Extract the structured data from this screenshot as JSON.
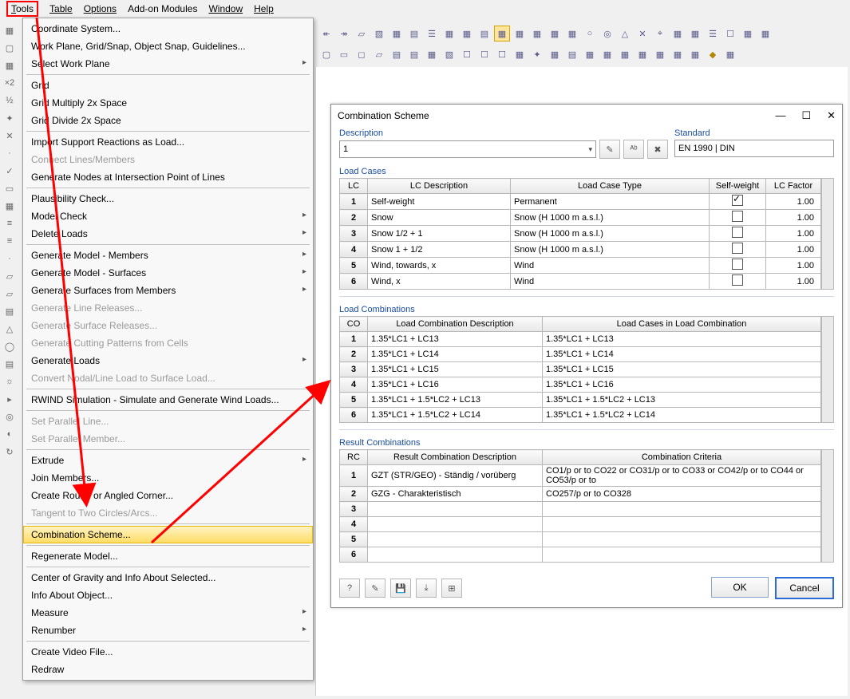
{
  "menubar": {
    "tools": "Tools",
    "table": "Table",
    "options": "Options",
    "addon": "Add-on Modules",
    "window": "Window",
    "help": "Help"
  },
  "menu": {
    "coord": "Coordinate System...",
    "workplane": "Work Plane, Grid/Snap, Object Snap, Guidelines...",
    "selectwp": "Select Work Plane",
    "grid": "Grid",
    "gridmul": "Grid Multiply 2x Space",
    "griddiv": "Grid Divide 2x Space",
    "impsupport": "Import Support Reactions as Load...",
    "connect": "Connect Lines/Members",
    "gennodes": "Generate Nodes at Intersection Point of Lines",
    "plaus": "Plausibility Check...",
    "modelcheck": "Model Check",
    "delloads": "Delete Loads",
    "genmembers": "Generate Model - Members",
    "gensurfaces": "Generate Model - Surfaces",
    "gensurffrom": "Generate Surfaces from Members",
    "genlinerel": "Generate Line Releases...",
    "gensurfrel": "Generate Surface Releases...",
    "gencut": "Generate Cutting Patterns from Cells",
    "genloads": "Generate Loads",
    "convnodal": "Convert Nodal/Line Load to Surface Load...",
    "rwind": "RWIND Simulation - Simulate and Generate Wind Loads...",
    "setparline": "Set Parallel Line...",
    "setparmem": "Set Parallel Member...",
    "extrude": "Extrude",
    "joinmem": "Join Members...",
    "createround": "Create Round or Angled Corner...",
    "tangent": "Tangent to Two Circles/Arcs...",
    "combsch": "Combination Scheme...",
    "regen": "Regenerate Model...",
    "cog": "Center of Gravity and Info About Selected...",
    "infoobj": "Info About Object...",
    "measure": "Measure",
    "renumber": "Renumber",
    "createvid": "Create Video File...",
    "redraw": "Redraw"
  },
  "dialog": {
    "title": "Combination Scheme",
    "descLabel": "Description",
    "descValue": "1",
    "stdLabel": "Standard",
    "stdValue": "EN 1990 | DIN",
    "loadCasesTitle": "Load Cases",
    "loadCasesHeaders": {
      "lc": "LC",
      "desc": "LC Description",
      "type": "Load Case Type",
      "sw": "Self-weight",
      "factor": "LC Factor"
    },
    "loadCases": [
      {
        "n": "1",
        "desc": "Self-weight",
        "type": "Permanent",
        "sw": true,
        "factor": "1.00"
      },
      {
        "n": "2",
        "desc": "Snow",
        "type": "Snow (H <le> 1000 m a.s.l.)",
        "sw": false,
        "factor": "1.00"
      },
      {
        "n": "3",
        "desc": "Snow 1/2 + 1",
        "type": "Snow (H <le> 1000 m a.s.l.)",
        "sw": false,
        "factor": "1.00"
      },
      {
        "n": "4",
        "desc": "Snow 1 + 1/2",
        "type": "Snow (H <le> 1000 m a.s.l.)",
        "sw": false,
        "factor": "1.00"
      },
      {
        "n": "5",
        "desc": "Wind, towards, x",
        "type": "Wind",
        "sw": false,
        "factor": "1.00"
      },
      {
        "n": "6",
        "desc": "Wind, x",
        "type": "Wind",
        "sw": false,
        "factor": "1.00"
      }
    ],
    "loadCombTitle": "Load Combinations",
    "loadCombHeaders": {
      "co": "CO",
      "desc": "Load Combination Description",
      "cases": "Load Cases in Load Combination"
    },
    "loadComb": [
      {
        "n": "1",
        "desc": "1.35*LC1 + LC13",
        "cases": "1.35*LC1 + LC13"
      },
      {
        "n": "2",
        "desc": "1.35*LC1 + LC14",
        "cases": "1.35*LC1 + LC14"
      },
      {
        "n": "3",
        "desc": "1.35*LC1 + LC15",
        "cases": "1.35*LC1 + LC15"
      },
      {
        "n": "4",
        "desc": "1.35*LC1 + LC16",
        "cases": "1.35*LC1 + LC16"
      },
      {
        "n": "5",
        "desc": "1.35*LC1 + 1.5*LC2 + LC13",
        "cases": "1.35*LC1 + 1.5*LC2 + LC13"
      },
      {
        "n": "6",
        "desc": "1.35*LC1 + 1.5*LC2 + LC14",
        "cases": "1.35*LC1 + 1.5*LC2 + LC14"
      }
    ],
    "resultCombTitle": "Result Combinations",
    "resultCombHeaders": {
      "rc": "RC",
      "desc": "Result Combination Description",
      "crit": "Combination Criteria"
    },
    "resultComb": [
      {
        "n": "1",
        "desc": "GZT (STR/GEO) - Ständig / vorüberg",
        "crit": "CO1/p or to CO22 or CO31/p or to CO33 or CO42/p or to CO44 or CO53/p or to"
      },
      {
        "n": "2",
        "desc": "GZG - Charakteristisch",
        "crit": "CO257/p or to CO328"
      },
      {
        "n": "3",
        "desc": "",
        "crit": ""
      },
      {
        "n": "4",
        "desc": "",
        "crit": ""
      },
      {
        "n": "5",
        "desc": "",
        "crit": ""
      },
      {
        "n": "6",
        "desc": "",
        "crit": ""
      }
    ],
    "ok": "OK",
    "cancel": "Cancel"
  }
}
